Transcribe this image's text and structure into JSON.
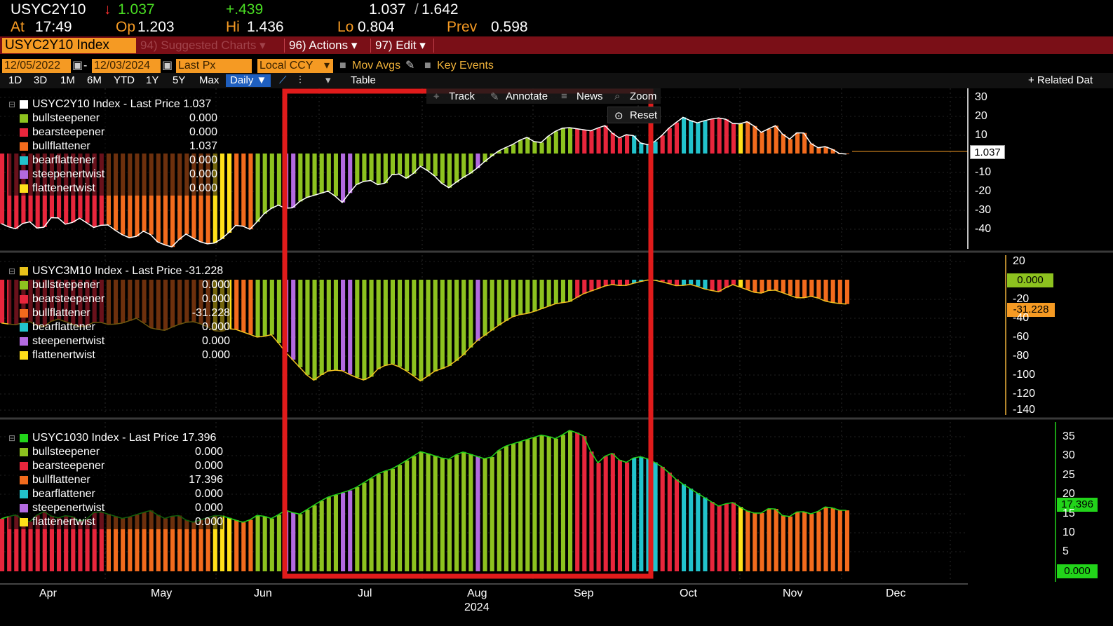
{
  "header": {
    "ticker": "USYC2Y10",
    "arrow": "↓",
    "last": "1.037",
    "change": "+.439",
    "range": "1.037",
    "range_sep": "/",
    "range_hi": "1.642",
    "at_label": "At",
    "at_value": "17:49",
    "op_label": "Op",
    "op_value": "1.203",
    "hi_label": "Hi",
    "hi_value": "1.436",
    "lo_label": "Lo",
    "lo_value": "0.804",
    "prev_label": "Prev",
    "prev_value": "0.598"
  },
  "menu": {
    "security": "USYC2Y10 Index",
    "suggested": "94) Suggested Charts ▾",
    "actions": "96) Actions ▾",
    "edit": "97) Edit ▾"
  },
  "controls": {
    "start_date": "12/05/2022",
    "date_sep": "-",
    "end_date": "12/03/2024",
    "field": "Last Px",
    "currency": "Local CCY",
    "mov_avgs": "Mov Avgs",
    "key_events": "Key Events"
  },
  "periods": [
    "1D",
    "3D",
    "1M",
    "6M",
    "YTD",
    "1Y",
    "5Y",
    "Max"
  ],
  "frequency": "Daily ▼",
  "table_label": "Table",
  "related_label": "+ Related Dat",
  "tools": {
    "track": "Track",
    "annotate": "Annotate",
    "news": "News",
    "zoom": "Zoom",
    "reset": "Reset"
  },
  "colors": {
    "bullsteepener": "#8dc21f",
    "bearsteepener": "#e8263c",
    "bullflattener": "#f26b1d",
    "bearflattener": "#22c3cc",
    "steepenertwist": "#b36ae0",
    "flattenertwist": "#ffe01a",
    "highlight_box": "#e01b1b",
    "accent_orange": "#f59a23"
  },
  "panels": [
    {
      "title": "USYC2Y10 Index - Last Price 1.037",
      "swatch": "#ffffff",
      "items": [
        {
          "name": "bullsteepener",
          "value": "0.000"
        },
        {
          "name": "bearsteepener",
          "value": "0.000"
        },
        {
          "name": "bullflattener",
          "value": "1.037"
        },
        {
          "name": "bearflattener",
          "value": "0.000"
        },
        {
          "name": "steepenertwist",
          "value": "0.000"
        },
        {
          "name": "flattenertwist",
          "value": "0.000"
        }
      ],
      "axis_ticks": [
        "30",
        "20",
        "10",
        "-10",
        "-20",
        "-30",
        "-40"
      ],
      "last_tag": "1.037"
    },
    {
      "title": "USYC3M10 Index - Last Price -31.228",
      "swatch": "#e8c21a",
      "items": [
        {
          "name": "bullsteepener",
          "value": "0.000"
        },
        {
          "name": "bearsteepener",
          "value": "0.000"
        },
        {
          "name": "bullflattener",
          "value": "-31.228"
        },
        {
          "name": "bearflattener",
          "value": "0.000"
        },
        {
          "name": "steepenertwist",
          "value": "0.000"
        },
        {
          "name": "flattenertwist",
          "value": "0.000"
        }
      ],
      "axis_ticks": [
        "20",
        "-20",
        "-40",
        "-60",
        "-80",
        "-100",
        "-120",
        "-140"
      ],
      "zero_tag": "0.000",
      "last_tag": "-31.228"
    },
    {
      "title": "USYC1030 Index - Last Price 17.396",
      "swatch": "#22d41a",
      "items": [
        {
          "name": "bullsteepener",
          "value": "0.000"
        },
        {
          "name": "bearsteepener",
          "value": "0.000"
        },
        {
          "name": "bullflattener",
          "value": "17.396"
        },
        {
          "name": "bearflattener",
          "value": "0.000"
        },
        {
          "name": "steepenertwist",
          "value": "0.000"
        },
        {
          "name": "flattenertwist",
          "value": "0.000"
        }
      ],
      "axis_ticks": [
        "35",
        "30",
        "25",
        "20",
        "15",
        "10",
        "5"
      ],
      "last_tag": "17.396",
      "zero_tag": "0.000"
    }
  ],
  "x_axis": {
    "months": [
      "Apr",
      "May",
      "Jun",
      "Jul",
      "Aug",
      "Sep",
      "Oct",
      "Nov",
      "Dec"
    ],
    "year": "2024"
  },
  "chart_data": [
    {
      "type": "bar",
      "series_name": "USYC2Y10 Index",
      "ylim": [
        -48,
        35
      ],
      "regimes": [
        {
          "regime": "bearsteepener",
          "from": 0.0,
          "to": 0.12
        },
        {
          "regime": "bullflattener",
          "from": 0.12,
          "to": 0.25
        },
        {
          "regime": "flattenertwist",
          "from": 0.25,
          "to": 0.27
        },
        {
          "regime": "bullflattener",
          "from": 0.27,
          "to": 0.3
        },
        {
          "regime": "bullsteepener",
          "from": 0.3,
          "to": 0.33
        },
        {
          "regime": "steepenertwist",
          "from": 0.33,
          "to": 0.35
        },
        {
          "regime": "bullsteepener",
          "from": 0.35,
          "to": 0.4
        },
        {
          "regime": "steepenertwist",
          "from": 0.4,
          "to": 0.41
        },
        {
          "regime": "bullsteepener",
          "from": 0.41,
          "to": 0.555
        },
        {
          "regime": "steepenertwist",
          "from": 0.555,
          "to": 0.56
        },
        {
          "regime": "bullsteepener",
          "from": 0.56,
          "to": 0.67
        },
        {
          "regime": "steepenertwist",
          "from": 0.67,
          "to": 0.675
        },
        {
          "regime": "bearsteepener",
          "from": 0.675,
          "to": 0.74
        },
        {
          "regime": "bearflattener",
          "from": 0.74,
          "to": 0.77
        },
        {
          "regime": "bearsteepener",
          "from": 0.77,
          "to": 0.8
        },
        {
          "regime": "bearflattener",
          "from": 0.8,
          "to": 0.83
        },
        {
          "regime": "bearsteepener",
          "from": 0.83,
          "to": 0.86
        },
        {
          "regime": "flattenertwist",
          "from": 0.86,
          "to": 0.875
        }
      ],
      "line": [
        -35,
        -38,
        -33,
        -39,
        -30,
        -36,
        -32,
        -37,
        -35,
        -40,
        -43,
        -38,
        -45,
        -47,
        -40,
        -44,
        -46,
        -42,
        -35,
        -38,
        -30,
        -25,
        -28,
        -22,
        -20,
        -18,
        -24,
        -15,
        -12,
        -16,
        -8,
        -12,
        -5,
        -10,
        -17,
        -12,
        -8,
        -2,
        3,
        6,
        10,
        6,
        12,
        15,
        14,
        13,
        16,
        9,
        12,
        5,
        8,
        15,
        20,
        17,
        19,
        20,
        16,
        18,
        12,
        16,
        8,
        14,
        4,
        5,
        1,
        1
      ]
    },
    {
      "type": "bar",
      "series_name": "USYC3M10 Index",
      "ylim": [
        -145,
        20
      ],
      "line": [
        -50,
        -52,
        -48,
        -55,
        -45,
        -50,
        -55,
        -48,
        -52,
        -50,
        -45,
        -55,
        -58,
        -52,
        -48,
        -52,
        -60,
        -55,
        -60,
        -65,
        -62,
        -80,
        -95,
        -110,
        -100,
        -98,
        -105,
        -110,
        -95,
        -92,
        -100,
        -110,
        -100,
        -95,
        -85,
        -70,
        -60,
        -50,
        -42,
        -40,
        -35,
        -30,
        -28,
        -20,
        -15,
        -10,
        -12,
        -8,
        -5,
        -8,
        -12,
        -10,
        -15,
        -18,
        -10,
        -15,
        -20,
        -15,
        -20,
        -25,
        -22,
        -28,
        -30,
        -31
      ]
    },
    {
      "type": "bar",
      "series_name": "USYC1030 Index",
      "ylim": [
        0,
        38
      ],
      "line": [
        15,
        16,
        14,
        17,
        15,
        16,
        14,
        17,
        16,
        15,
        16,
        17,
        15,
        16,
        14,
        15,
        16,
        15,
        14,
        16,
        15,
        17,
        16,
        18,
        20,
        21,
        22,
        24,
        26,
        27,
        29,
        31,
        30,
        29,
        31,
        30,
        29,
        32,
        33,
        34,
        35,
        34,
        36,
        35,
        28,
        31,
        28,
        30,
        29,
        27,
        24,
        22,
        20,
        18,
        19,
        17,
        16,
        18,
        15,
        17,
        16,
        18,
        17,
        17
      ]
    }
  ]
}
